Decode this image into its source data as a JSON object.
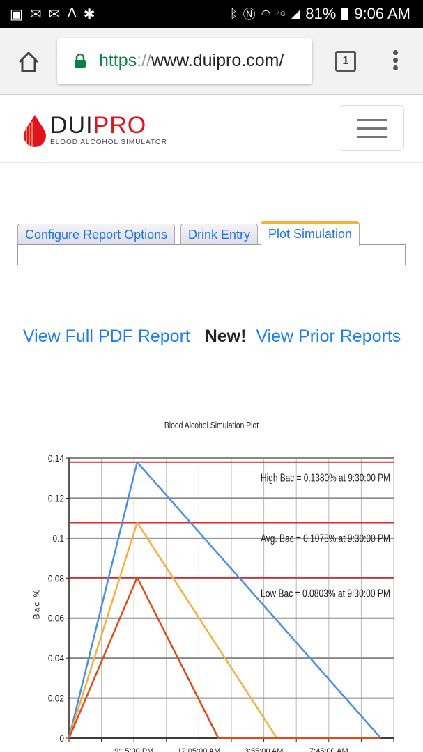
{
  "status_bar": {
    "notification_icons": [
      "gallery-icon",
      "email-icon",
      "email-icon",
      "a-icon",
      "asterisk-icon"
    ],
    "system_icons": [
      "bluetooth-icon",
      "nfc-icon",
      "wifi-icon",
      "4g-icon",
      "signal-icon"
    ],
    "battery": "81%",
    "time": "9:06 AM"
  },
  "browser": {
    "url_scheme": "https",
    "url_sep": "://",
    "url_rest": "www.duipro.com/",
    "tab_count": "1"
  },
  "site": {
    "logo_dui": "DUI",
    "logo_pro": "PRO",
    "logo_sub": "BLOOD ALCOHOL SIMULATOR",
    "brand_red": "#e0141e"
  },
  "tabs": [
    {
      "label": "Configure Report Options",
      "active": false
    },
    {
      "label": "Drink Entry",
      "active": false
    },
    {
      "label": "Plot Simulation",
      "active": true
    }
  ],
  "links": {
    "pdf": "View Full PDF Report",
    "new": "New!",
    "prior": "View Prior Reports"
  },
  "chart_data": {
    "type": "line",
    "title": "Blood Alcohol Simulation Plot",
    "ylabel": "Bac %",
    "xlabel": "",
    "ylim": [
      0,
      0.14
    ],
    "yticks": [
      "0",
      "0.02",
      "0.04",
      "0.06",
      "0.08",
      "0.1",
      "0.12",
      "0.14"
    ],
    "xticks": [
      "9:15:00 PM",
      "12:05:00 AM",
      "3:55:00 AM",
      "7:45:00 AM"
    ],
    "grid": true,
    "x_range_gridlines": [
      0,
      10
    ],
    "series": [
      {
        "name": "High Bac",
        "color": "#4a90e2",
        "points": [
          [
            0,
            0
          ],
          [
            2.1,
            0.138
          ],
          [
            9.6,
            0
          ]
        ]
      },
      {
        "name": "Avg. Bac",
        "color": "#f5b041",
        "points": [
          [
            0,
            0
          ],
          [
            2.1,
            0.1078
          ],
          [
            6.4,
            0
          ]
        ]
      },
      {
        "name": "Low Bac",
        "color": "#dd4b1a",
        "points": [
          [
            0,
            0
          ],
          [
            2.1,
            0.0803
          ],
          [
            4.6,
            0
          ],
          [
            9.6,
            0
          ]
        ]
      }
    ],
    "reference_lines": [
      {
        "value": 0.138,
        "label": "High Bac = 0.1380% at  9:30:00 PM"
      },
      {
        "value": 0.1078,
        "label": "Avg. Bac = 0.1078% at  9:30:00 PM"
      },
      {
        "value": 0.0803,
        "label": "Low Bac = 0.0803% at  9:30:00 PM"
      }
    ],
    "reference_color": "#e8232a"
  }
}
